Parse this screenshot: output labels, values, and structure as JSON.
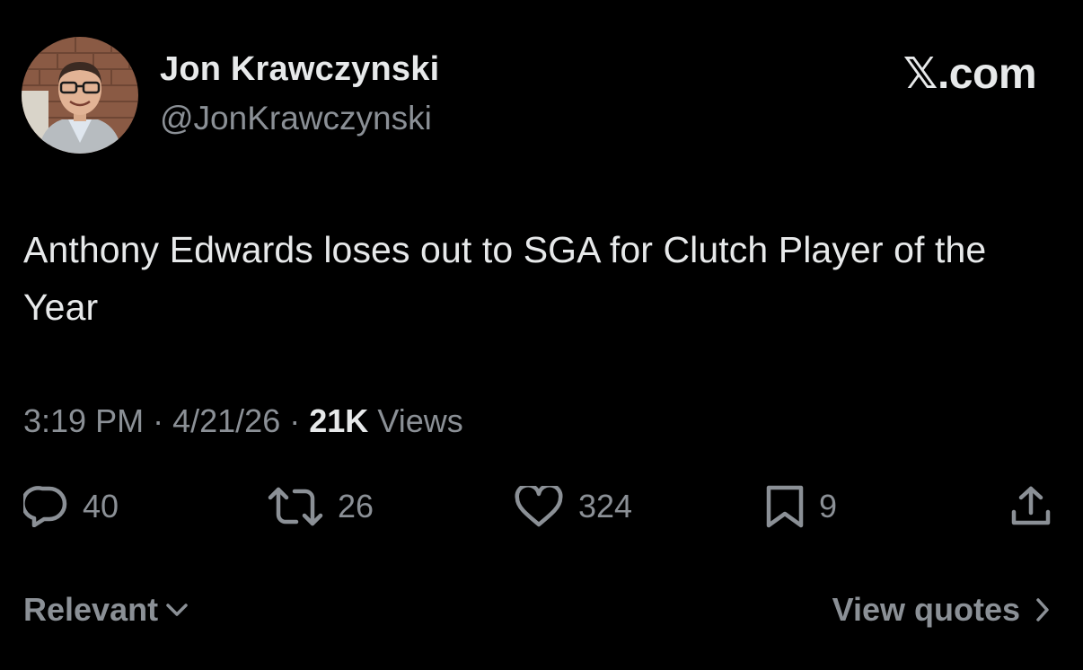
{
  "author": {
    "display_name": "Jon Krawczynski",
    "handle": "@JonKrawczynski",
    "avatar_icon": "profile-photo"
  },
  "brand": {
    "label": "𝕏.com"
  },
  "tweet": {
    "text": "Anthony Edwards loses out to SGA for Clutch Player of the Year"
  },
  "meta": {
    "time": "3:19 PM",
    "separator": "·",
    "date": "4/21/26",
    "views_count": "21K",
    "views_label": "Views"
  },
  "actions": {
    "replies": {
      "icon": "reply-icon",
      "count": "40"
    },
    "reposts": {
      "icon": "repost-icon",
      "count": "26"
    },
    "likes": {
      "icon": "heart-icon",
      "count": "324"
    },
    "bookmarks": {
      "icon": "bookmark-icon",
      "count": "9"
    },
    "share": {
      "icon": "share-icon"
    }
  },
  "footer": {
    "sort_label": "Relevant",
    "view_quotes_label": "View quotes"
  },
  "colors": {
    "background": "#000000",
    "primary_text": "#e7e9ea",
    "secondary_text": "#8b9096"
  }
}
